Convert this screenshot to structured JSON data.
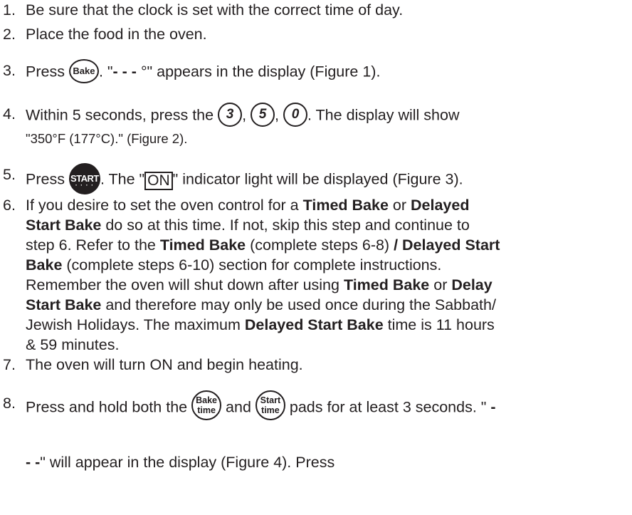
{
  "steps": [
    {
      "num": "1.",
      "text": "Be sure that the clock is set with the correct time of day."
    },
    {
      "num": "2.",
      "text": "Place the food in the oven."
    },
    {
      "num": "3.",
      "pre": "Press ",
      "pad": "Bake",
      "post_a": ". \"",
      "bold": "- - - ",
      "post_b": "°\" appears in the display (Figure 1)."
    },
    {
      "num": "4.",
      "pre": "Within 5 seconds, press the ",
      "digits": [
        "3",
        "5",
        "0"
      ],
      "sep": ", ",
      "post": ". The display will show",
      "line2": "\"350°F (177°C).\" (Figure 2)."
    },
    {
      "num": "5.",
      "pre": "Press ",
      "pad": "START",
      "pad_dots": "· · · ·",
      "mid": ". The \"",
      "on": "ON",
      "post": "\" indicator light will be displayed (Figure 3)."
    },
    {
      "num": "6.",
      "lines": [
        [
          {
            "t": "If you desire to set the oven control for a "
          },
          {
            "b": "Timed Bake"
          },
          {
            "t": " or "
          },
          {
            "b": "Delayed"
          }
        ],
        [
          {
            "b": "Start Bake"
          },
          {
            "t": " do so at this time. If not, skip this step and continue to"
          }
        ],
        [
          {
            "t": "step 6. Refer to the "
          },
          {
            "b": "Timed Bake"
          },
          {
            "t": " (complete steps 6-8) "
          },
          {
            "b": "/ Delayed Start"
          }
        ],
        [
          {
            "b": "Bake"
          },
          {
            "t": " (complete steps 6-10) section for complete instructions."
          }
        ],
        [
          {
            "t": "Remember the oven will shut down after using "
          },
          {
            "b": "Timed Bake"
          },
          {
            "t": " or "
          },
          {
            "b": "Delay"
          }
        ],
        [
          {
            "b": "Start Bake"
          },
          {
            "t": " and therefore may only be used once during the Sabbath/"
          }
        ],
        [
          {
            "t": "Jewish Holidays. The maximum "
          },
          {
            "b": "Delayed Start Bake"
          },
          {
            "t": " time is 11 hours"
          }
        ],
        [
          {
            "t": "& 59 minutes."
          }
        ]
      ]
    },
    {
      "num": "7.",
      "text": "The oven will turn ON and begin heating."
    },
    {
      "num": "8.",
      "pre": "Press and hold both the ",
      "pad1_top": "Bake",
      "pad1_bot": "time",
      "mid": " and ",
      "pad2_top": "Start",
      "pad2_bot": "time",
      "post": " pads for at least 3 seconds. \" ",
      "post_bold": "-",
      "line2_bold": "- -",
      "line2": "\" will appear in the display (Figure 4). Press"
    }
  ]
}
